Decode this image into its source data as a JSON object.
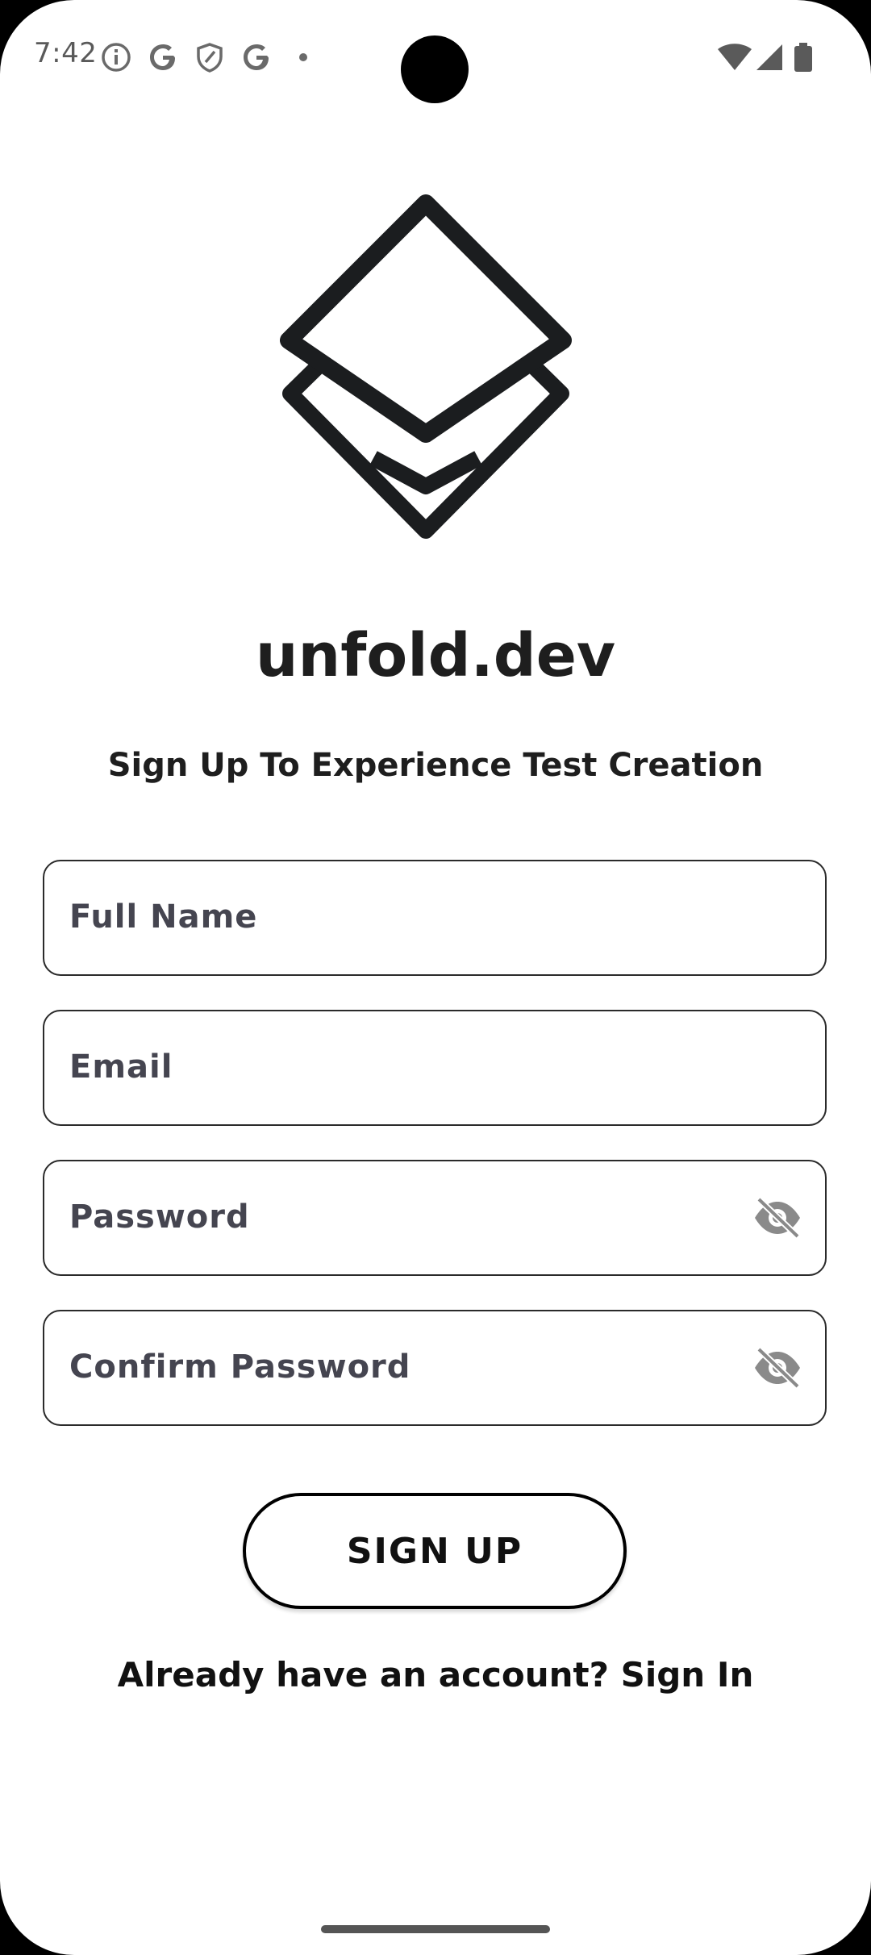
{
  "status_bar": {
    "time": "7:42",
    "left_icons": [
      "info-icon",
      "google-icon",
      "shield-icon",
      "google-icon",
      "dot-icon"
    ],
    "right_icons": [
      "wifi-icon",
      "cellular-signal-icon",
      "battery-icon"
    ]
  },
  "app": {
    "name": "unfold.dev",
    "tagline": "Sign Up To Experience Test Creation"
  },
  "form": {
    "full_name_placeholder": "Full Name",
    "email_placeholder": "Email",
    "password_placeholder": "Password",
    "confirm_password_placeholder": "Confirm Password",
    "submit_label": "SIGN UP",
    "signin_prompt": "Already have an account? Sign In"
  },
  "colors": {
    "background": "#ffffff",
    "text_primary": "#1e1e1e",
    "placeholder_text": "#454550",
    "field_border": "#2a2a2a",
    "icon_gray": "#7a7a7a"
  }
}
